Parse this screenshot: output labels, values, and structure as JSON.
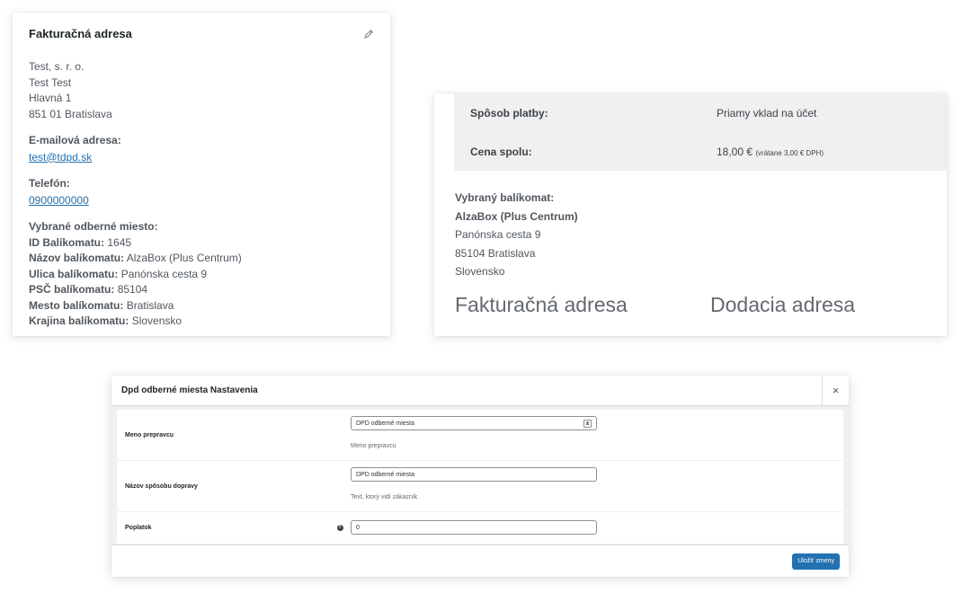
{
  "billing": {
    "title": "Fakturačná adresa",
    "address_lines": [
      "Test, s. r. o.",
      "Test Test",
      "Hlavná 1",
      "851 01 Bratislava"
    ],
    "email_label": "E-mailová adresa:",
    "email": "test@tdpd.sk",
    "phone_label": "Telefón:",
    "phone": "0900000000",
    "pickup_heading": "Vybrané odberné miesto:",
    "pickup_fields": [
      {
        "label": "ID Balíkomatu:",
        "value": " 1645"
      },
      {
        "label": "Názov balíkomatu:",
        "value": " AlzaBox (Plus Centrum)"
      },
      {
        "label": "Ulica balíkomatu:",
        "value": " Panónska cesta 9"
      },
      {
        "label": "PSČ balíkomatu:",
        "value": " 85104"
      },
      {
        "label": "Mesto balíkomatu:",
        "value": " Bratislava"
      },
      {
        "label": "Krajina balíkomatu:",
        "value": " Slovensko"
      }
    ]
  },
  "order": {
    "rows": [
      {
        "label": "Spôsob platby:",
        "value": "Priamy vklad na účet",
        "note": ""
      },
      {
        "label": "Cena spolu:",
        "value": "18,00 €",
        "note": "(vrátane 3,00 € DPH)"
      }
    ],
    "pickup_heading": "Vybraný balíkomat:",
    "pickup_name": "AlzaBox (Plus Centrum)",
    "pickup_lines": [
      "Panónska cesta 9",
      "85104 Bratislava",
      "Slovensko"
    ],
    "billing_heading": "Fakturačná adresa",
    "shipping_heading": "Dodacia adresa"
  },
  "modal": {
    "title": "Dpd odberné miesta Nastavenia",
    "close_glyph": "×",
    "fields": [
      {
        "label": "Meno prepravcu",
        "value": "DPD odberné miesta",
        "description": "Meno prepravcu"
      },
      {
        "label": "Názov spôsobu dopravy",
        "value": "DPD odberné miesta",
        "description": "Text, ktorý vidí zákazník"
      },
      {
        "label": "Poplatok",
        "value": "0",
        "description": ""
      }
    ],
    "help_glyph": "?",
    "save_label": "Uložiť zmeny"
  },
  "icons": {
    "edit": "pencil-icon",
    "close": "close-icon",
    "help": "help-icon",
    "language": "language-icon"
  },
  "colors": {
    "link": "#2271b1",
    "primary_button": "#2271b1",
    "panel_bg": "#f0f0f1"
  }
}
